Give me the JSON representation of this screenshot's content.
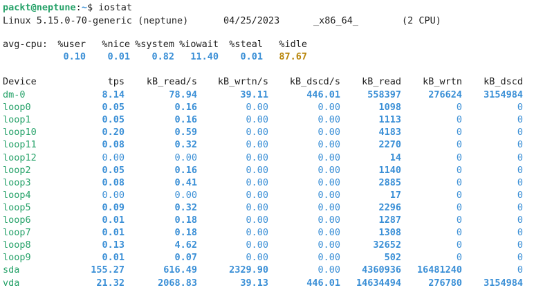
{
  "prompt": {
    "user_host": "packt@neptune",
    "separator": ":",
    "path": "~",
    "symbol": "$",
    "command": " iostat"
  },
  "sysinfo": {
    "kernel": "Linux 5.15.0-70-generic (neptune)",
    "date": "04/25/2023",
    "arch": "_x86_64_",
    "cpus": "(2 CPU)"
  },
  "cpu": {
    "label": "avg-cpu:",
    "headers": [
      "%user",
      "%nice",
      "%system",
      "%iowait",
      "%steal",
      "%idle"
    ],
    "values": [
      "0.10",
      "0.01",
      "0.82",
      "11.40",
      "0.01",
      "87.67"
    ]
  },
  "devices": {
    "headers": [
      "Device",
      "tps",
      "kB_read/s",
      "kB_wrtn/s",
      "kB_dscd/s",
      "kB_read",
      "kB_wrtn",
      "kB_dscd"
    ],
    "rows": [
      [
        "dm-0",
        "8.14",
        "78.94",
        "39.11",
        "446.01",
        "558397",
        "276624",
        "3154984"
      ],
      [
        "loop0",
        "0.05",
        "0.16",
        "0.00",
        "0.00",
        "1098",
        "0",
        "0"
      ],
      [
        "loop1",
        "0.05",
        "0.16",
        "0.00",
        "0.00",
        "1113",
        "0",
        "0"
      ],
      [
        "loop10",
        "0.20",
        "0.59",
        "0.00",
        "0.00",
        "4183",
        "0",
        "0"
      ],
      [
        "loop11",
        "0.08",
        "0.32",
        "0.00",
        "0.00",
        "2270",
        "0",
        "0"
      ],
      [
        "loop12",
        "0.00",
        "0.00",
        "0.00",
        "0.00",
        "14",
        "0",
        "0"
      ],
      [
        "loop2",
        "0.05",
        "0.16",
        "0.00",
        "0.00",
        "1140",
        "0",
        "0"
      ],
      [
        "loop3",
        "0.08",
        "0.41",
        "0.00",
        "0.00",
        "2885",
        "0",
        "0"
      ],
      [
        "loop4",
        "0.00",
        "0.00",
        "0.00",
        "0.00",
        "17",
        "0",
        "0"
      ],
      [
        "loop5",
        "0.09",
        "0.32",
        "0.00",
        "0.00",
        "2296",
        "0",
        "0"
      ],
      [
        "loop6",
        "0.01",
        "0.18",
        "0.00",
        "0.00",
        "1287",
        "0",
        "0"
      ],
      [
        "loop7",
        "0.01",
        "0.18",
        "0.00",
        "0.00",
        "1308",
        "0",
        "0"
      ],
      [
        "loop8",
        "0.13",
        "4.62",
        "0.00",
        "0.00",
        "32652",
        "0",
        "0"
      ],
      [
        "loop9",
        "0.01",
        "0.07",
        "0.00",
        "0.00",
        "502",
        "0",
        "0"
      ],
      [
        "sda",
        "155.27",
        "616.49",
        "2329.90",
        "0.00",
        "4360936",
        "16481240",
        "0"
      ],
      [
        "vda",
        "21.32",
        "2068.83",
        "39.13",
        "446.01",
        "14634494",
        "276780",
        "3154984"
      ]
    ]
  },
  "colors": {
    "prompt_green": "#26a269",
    "value_blue": "#3a8fd6",
    "idle_orange": "#b8860b",
    "text": "#1e1e1e"
  }
}
